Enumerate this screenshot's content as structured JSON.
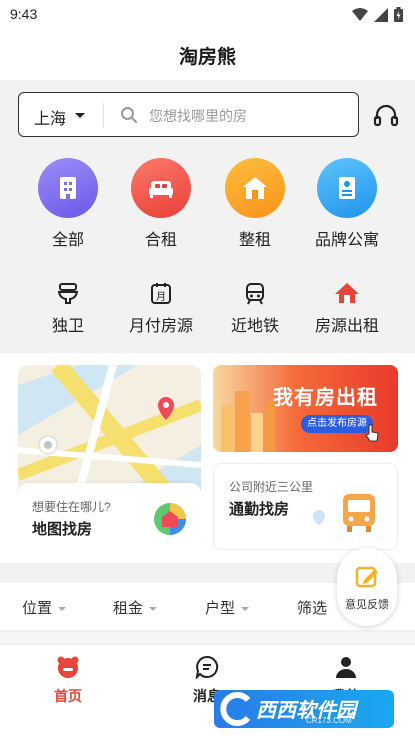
{
  "status_bar": {
    "time": "9:43"
  },
  "header": {
    "title": "淘房熊"
  },
  "search": {
    "city": "上海",
    "placeholder": "您想找哪里的房"
  },
  "categories_top": [
    {
      "label": "全部",
      "icon": "building-icon",
      "color": "#7b6cf0"
    },
    {
      "label": "合租",
      "icon": "bed-icon",
      "color": "#f2564a"
    },
    {
      "label": "整租",
      "icon": "house-icon",
      "color": "#f9a51c"
    },
    {
      "label": "品牌公寓",
      "icon": "document-icon",
      "color": "#2fa8f3"
    }
  ],
  "categories_bottom": [
    {
      "label": "独卫",
      "icon": "toilet-icon"
    },
    {
      "label": "月付房源",
      "icon": "calendar-month-icon"
    },
    {
      "label": "近地铁",
      "icon": "metro-icon"
    },
    {
      "label": "房源出租",
      "icon": "red-house-icon"
    }
  ],
  "cards": {
    "map_question": "想要住在哪儿?",
    "map_title": "地图找房",
    "rent_title": "我有房出租",
    "rent_button": "点击发布房源",
    "commute_question": "公司附近三公里",
    "commute_title": "通勤找房"
  },
  "filters": [
    "位置",
    "租金",
    "户型",
    "筛选"
  ],
  "feedback": {
    "label": "意见反馈"
  },
  "tabs": [
    {
      "label": "首页",
      "active": true
    },
    {
      "label": "消息",
      "active": false
    },
    {
      "label": "我的",
      "active": false
    }
  ],
  "watermark": {
    "text": "西西软件园",
    "sub": "CR173.COM"
  },
  "colors": {
    "accent": "#e8443a",
    "text": "#222222"
  }
}
